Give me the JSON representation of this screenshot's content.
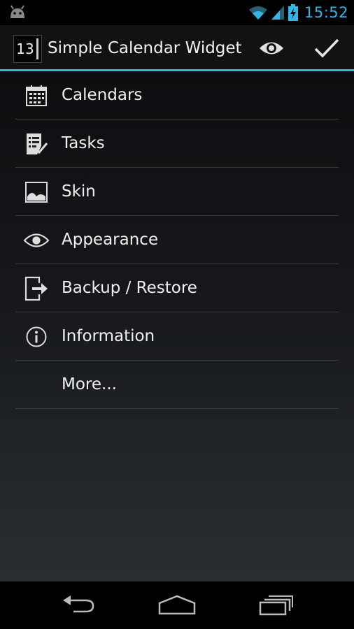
{
  "status_bar": {
    "time": "15:52",
    "left_icon": "android-icon",
    "icons": [
      "wifi-icon",
      "signal-icon",
      "battery-charging-icon"
    ]
  },
  "action_bar": {
    "app_icon_text": "13",
    "title": "Simple Calendar Widget",
    "actions": [
      "eye-icon",
      "check-icon"
    ]
  },
  "menu": {
    "items": [
      {
        "label": "Calendars",
        "icon": "calendar-icon"
      },
      {
        "label": "Tasks",
        "icon": "tasks-icon"
      },
      {
        "label": "Skin",
        "icon": "image-icon"
      },
      {
        "label": "Appearance",
        "icon": "eye-icon"
      },
      {
        "label": "Backup / Restore",
        "icon": "export-icon"
      },
      {
        "label": "Information",
        "icon": "info-icon"
      },
      {
        "label": "More...",
        "icon": ""
      }
    ]
  },
  "nav_bar": {
    "buttons": [
      "back-icon",
      "home-icon",
      "recent-apps-icon"
    ]
  },
  "colors": {
    "accent": "#33b5e5",
    "background_top": "#0d0e10",
    "background_bottom": "#2a2e33",
    "text": "#f0f0f0"
  }
}
